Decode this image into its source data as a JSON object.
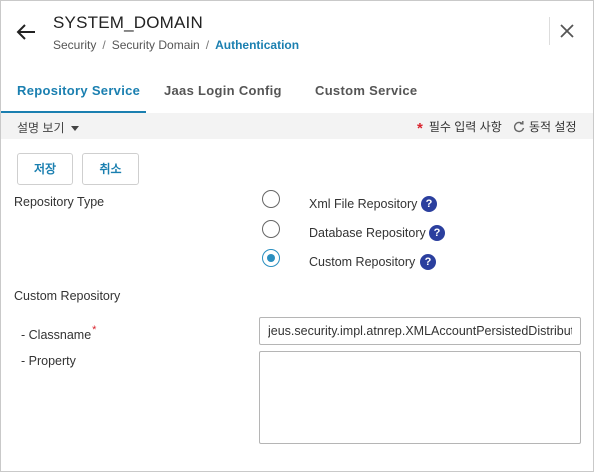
{
  "header": {
    "title": "SYSTEM_DOMAIN",
    "breadcrumb": [
      "Security",
      "Security Domain",
      "Authentication"
    ],
    "separator": "/"
  },
  "tabs": [
    {
      "label": "Repository Service",
      "active": true
    },
    {
      "label": "Jaas Login Config",
      "active": false
    },
    {
      "label": "Custom Service",
      "active": false
    }
  ],
  "infobar": {
    "description_toggle": "설명 보기",
    "required_legend": "필수 입력 사항",
    "required_symbol": "*",
    "dynamic_legend": "동적 설정"
  },
  "actions": {
    "save": "저장",
    "cancel": "취소"
  },
  "form": {
    "repository_type_label": "Repository Type",
    "repository_options": [
      {
        "label": "Xml File Repository",
        "checked": false
      },
      {
        "label": "Database Repository",
        "checked": false
      },
      {
        "label": "Custom Repository",
        "checked": true
      }
    ],
    "help_symbol": "?",
    "custom_repository_label": "Custom Repository",
    "classname_label": "- Classname",
    "classname_required_mark": "*",
    "classname_value": "jeus.security.impl.atnrep.XMLAccountPersistedDistribut",
    "property_label": "- Property",
    "property_value": ""
  },
  "colors": {
    "accent": "#1a7fb0",
    "required": "#d9232d",
    "help_badge": "#2b3f9e",
    "radio_checked": "#2a8fc0"
  }
}
